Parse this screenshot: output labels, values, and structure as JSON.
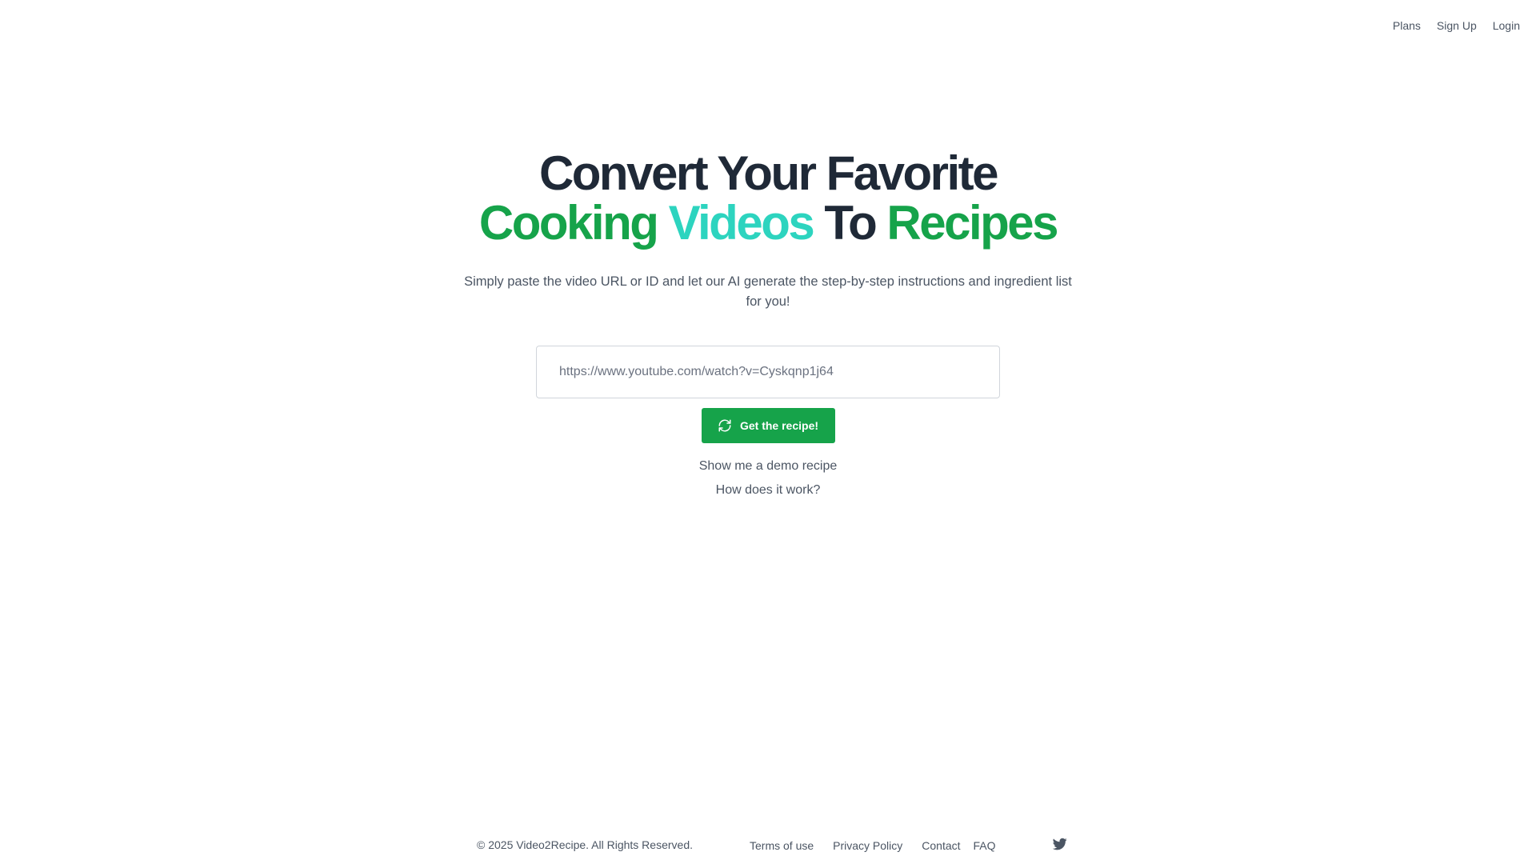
{
  "nav": {
    "plans": "Plans",
    "signup": "Sign Up",
    "login": "Login"
  },
  "hero": {
    "headline_part1": "Convert Your Favorite ",
    "headline_cooking": "Cooking",
    "headline_videos": "Videos",
    "headline_to": " To ",
    "headline_recipes": "Recipes",
    "subtitle": "Simply paste the video URL or ID and let our AI generate the step-by-step instructions and ingredient list for you!",
    "url_value": "https://www.youtube.com/watch?v=Cyskqnp1j64",
    "button_label": "Get the recipe!",
    "demo_link": "Show me a demo recipe",
    "how_link": "How does it work?"
  },
  "footer": {
    "copyright": "© 2025 Video2Recipe. All Rights Reserved.",
    "terms": "Terms of use",
    "privacy": "Privacy Policy",
    "contact": "Contact",
    "faq": "FAQ",
    "twitter_icon": "twitter-icon"
  },
  "colors": {
    "brand_green": "#16a34a",
    "accent_teal": "#2dd4bf",
    "text_dark": "#1f2937",
    "text_muted": "#4b5563"
  }
}
